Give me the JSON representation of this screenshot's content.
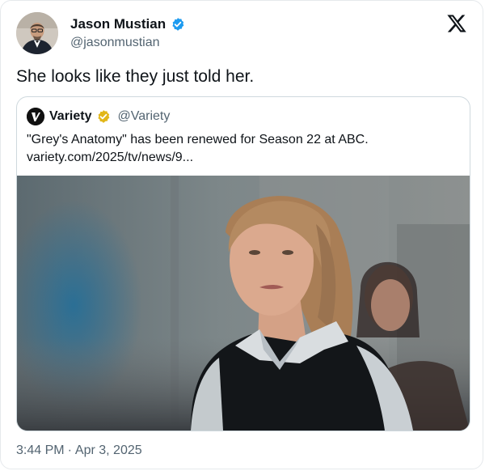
{
  "author": {
    "display_name": "Jason Mustian",
    "handle": "@jasonmustian",
    "verified": true
  },
  "post": {
    "text": "She looks like they just told her.",
    "time": "3:44 PM",
    "separator": "·",
    "date": "Apr 3, 2025"
  },
  "quoted_post": {
    "display_name": "Variety",
    "handle": "@Variety",
    "verified_badge": "gold",
    "text_line1": "\"Grey's Anatomy\" has been renewed for Season 22 at ABC.",
    "text_line2": "variety.com/2025/tv/news/9..."
  },
  "icons": {
    "brand": "x-logo-icon",
    "verified_blue": "verified-badge-icon",
    "verified_gold": "verified-gold-badge-icon"
  },
  "colors": {
    "text_primary": "#0f1419",
    "text_secondary": "#536471",
    "verified_blue": "#1d9bf0",
    "verified_gold": "#e2b719",
    "border": "#cfd9de"
  }
}
